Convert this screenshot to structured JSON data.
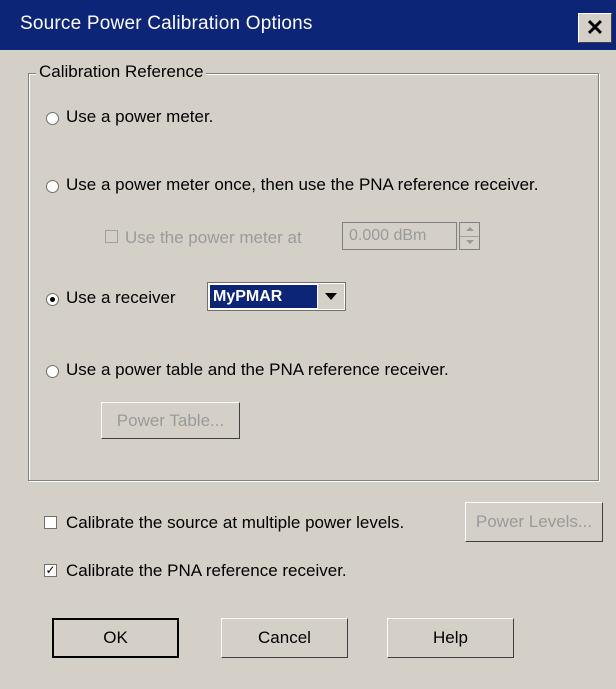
{
  "window": {
    "title": "Source Power Calibration Options",
    "close_label": "✕"
  },
  "calibration_reference": {
    "legend": "Calibration Reference",
    "options": [
      {
        "label": "Use a power meter.",
        "selected": false
      },
      {
        "label": "Use a power meter once, then use the PNA reference receiver.",
        "selected": false
      },
      {
        "label": "Use a receiver",
        "selected": true
      },
      {
        "label": "Use a power table and the PNA reference receiver.",
        "selected": false
      }
    ],
    "power_meter_at": {
      "label": "Use the power meter at",
      "checked": false,
      "enabled": false,
      "value": "0.000 dBm"
    },
    "receiver_select": {
      "value": "MyPMAR"
    },
    "power_table_button": "Power Table..."
  },
  "multiple_levels": {
    "label": "Calibrate the source at multiple power levels.",
    "checked": false,
    "button": "Power Levels..."
  },
  "reference_receiver": {
    "label": "Calibrate the PNA reference receiver.",
    "checked": true,
    "check_glyph": "✓"
  },
  "buttons": {
    "ok": "OK",
    "cancel": "Cancel",
    "help": "Help"
  }
}
